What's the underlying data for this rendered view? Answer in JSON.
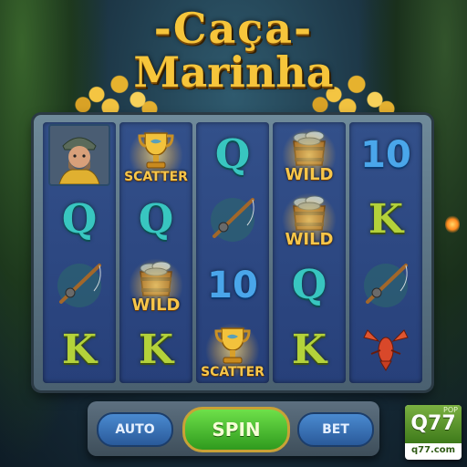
{
  "game": {
    "title_line1": "-Caça-",
    "title_line2": "Marinha"
  },
  "symbols": {
    "scatter_label": "SCATTER",
    "wild_label": "WILD",
    "letter_q": "Q",
    "letter_k": "K",
    "number_ten": "10"
  },
  "reels": [
    [
      "fisherman",
      "Q",
      "fishing-rod",
      "K"
    ],
    [
      "scatter",
      "Q",
      "wild",
      "K"
    ],
    [
      "Q",
      "fishing-rod",
      "10",
      "scatter"
    ],
    [
      "wild",
      "wild",
      "Q",
      "K"
    ],
    [
      "10",
      "K",
      "fishing-rod",
      "lobster"
    ]
  ],
  "controls": {
    "auto_label": "AUTO",
    "spin_label": "SPIN",
    "bet_label": "BET"
  },
  "logo": {
    "brand": "Q77",
    "small_text": "POP",
    "domain": "q77.com"
  },
  "colors": {
    "title_gold": "#f6c53b",
    "reel_blue": "#27407a",
    "q_teal": "#38c6c0",
    "k_green": "#b4d23a",
    "ten_blue": "#4aa6ea",
    "spin_green": "#2f9a1e"
  }
}
